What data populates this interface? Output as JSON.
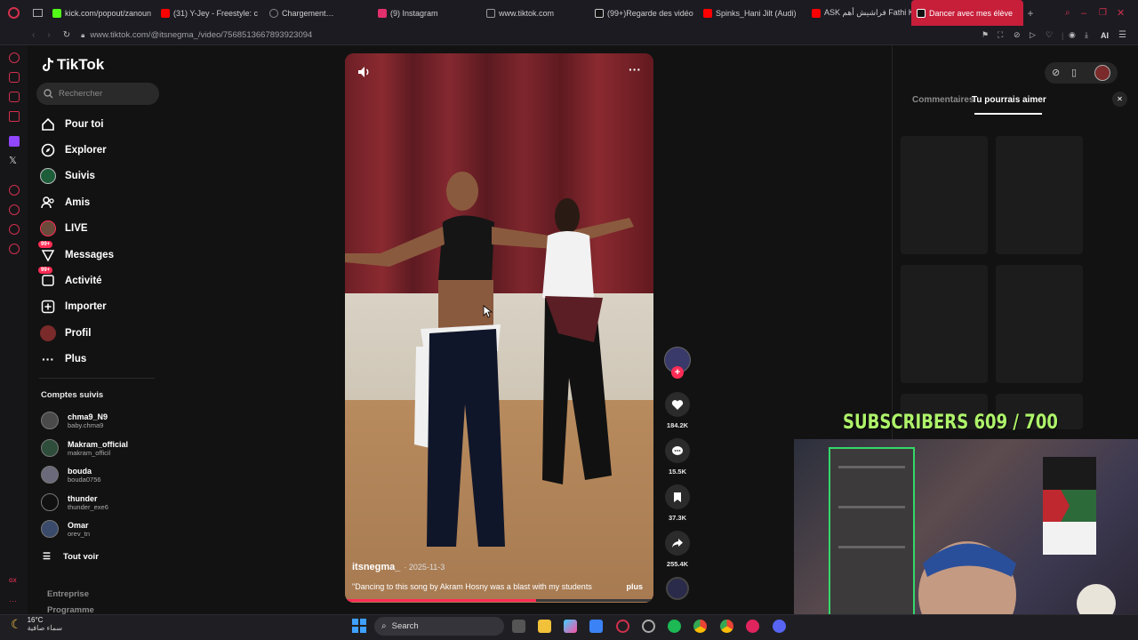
{
  "browser": {
    "tabs": [
      {
        "label": "kick.com/popout/zanoun",
        "color": "#53fc18"
      },
      {
        "label": "(31) Y-Jey - Freestyle: c",
        "color": "#ff0000"
      },
      {
        "label": "Chargement…",
        "color": "#888888"
      },
      {
        "label": "(9) Instagram",
        "color": "#e1306c"
      },
      {
        "label": "www.tiktok.com",
        "color": "#444444"
      },
      {
        "label": "(99+)Regarde des vidéo",
        "color": "#ffffff"
      },
      {
        "label": "Spinks_Hani Jilt (Audi)",
        "color": "#ff0000"
      },
      {
        "label": "ASK فراشيش أهم Fathi Ko",
        "color": "#ff0000"
      },
      {
        "label": "Dancer avec mes élève",
        "color": "#ffffff"
      }
    ],
    "url": "www.tiktok.com/@itsnegma_/video/7568513667893923094",
    "ai_label": "AI",
    "accent": "#c71e3a"
  },
  "sidebar": {
    "logo": "TikTok",
    "search_placeholder": "Rechercher",
    "nav": [
      {
        "label": "Pour toi",
        "icon": "home-icon"
      },
      {
        "label": "Explorer",
        "icon": "compass-icon"
      },
      {
        "label": "Suivis",
        "icon": "following-avatar"
      },
      {
        "label": "Amis",
        "icon": "friends-icon"
      },
      {
        "label": "LIVE",
        "icon": "live-avatar"
      },
      {
        "label": "Messages",
        "icon": "messages-icon",
        "badge": "99+"
      },
      {
        "label": "Activité",
        "icon": "activity-icon",
        "badge": "99+"
      },
      {
        "label": "Importer",
        "icon": "upload-icon"
      },
      {
        "label": "Profil",
        "icon": "profile-avatar"
      },
      {
        "label": "Plus",
        "icon": "more-icon"
      }
    ],
    "following_title": "Comptes suivis",
    "following": [
      {
        "name": "chma9_N9",
        "handle": "baby.chma9"
      },
      {
        "name": "Makram_official",
        "handle": "makram_officil"
      },
      {
        "name": "bouda",
        "handle": "bouda0756"
      },
      {
        "name": "thunder",
        "handle": "thunder_exe6"
      },
      {
        "name": "Omar",
        "handle": "orev_tn"
      }
    ],
    "see_all": "Tout voir",
    "footer": [
      "Entreprise",
      "Programme"
    ]
  },
  "video": {
    "username": "itsnegma_",
    "date": "· 2025-11-3",
    "caption": "\"Dancing to this song by Akram Hosny was a blast with my students",
    "more": "plus",
    "progress": 0.62
  },
  "actions": {
    "likes": "184.2K",
    "comments": "15.5K",
    "saves": "37.3K",
    "shares": "255.4K",
    "like_color": "#ffffff",
    "follow_color": "#fe2c55"
  },
  "right_panel": {
    "tab_comments": "Commentaires",
    "tab_suggested": "Tu pourrais aimer"
  },
  "overlay": {
    "subscribers": "SUBSCRIBERS 609 / 700"
  },
  "taskbar": {
    "temperature": "16°C",
    "weather": "سماء صافية",
    "search": "Search"
  }
}
